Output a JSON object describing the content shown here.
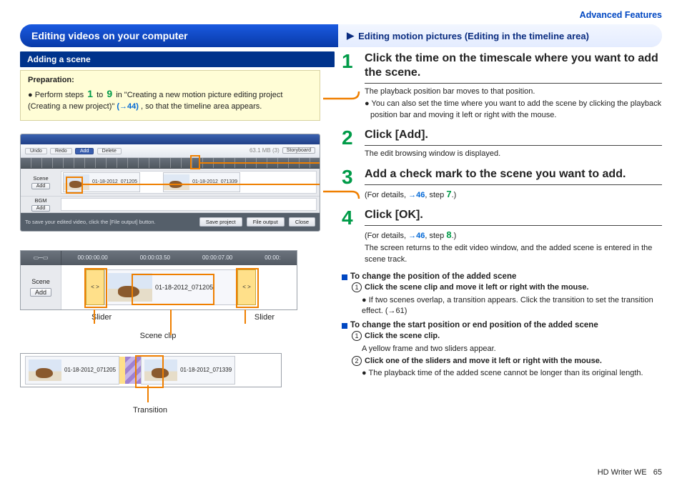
{
  "header": {
    "top_link": "Advanced Features",
    "left": "Editing videos on your computer",
    "right": "Editing motion pictures (Editing in the timeline area)"
  },
  "subheader": "Adding a scene",
  "prep": {
    "title": "Preparation:",
    "pre": "Perform steps ",
    "n1": "1",
    "mid": " to ",
    "n2": "9",
    "post1": " in \"Creating a new motion picture editing project (Creating a new project)\" ",
    "link": "(→44)",
    "post2": ", so that the timeline area appears."
  },
  "app": {
    "tabs": {
      "undo": "Undo",
      "redo": "Redo",
      "add": "Add",
      "delete": "Delete"
    },
    "size": "63.1 MB (3)",
    "storyboard": "Storyboard",
    "scene_label": "Scene",
    "add_btn": "Add",
    "bgm_label": "BGM",
    "clip1": "01-18-2012_071205",
    "clip2": "01-18-2012_071339",
    "foot_msg": "To save your edited video, click the [File output] button.",
    "save": "Save project",
    "file_out": "File output",
    "close": "Close"
  },
  "fig2": {
    "scene": "Scene",
    "add": "Add",
    "t0": "00:00:00.00",
    "t1": "00:00:03.50",
    "t2": "00:00:07.00",
    "t3": "00:00:",
    "sl": "< >",
    "clip": "01-18-2012_071205",
    "slider_l": "Slider",
    "slider_r": "Slider",
    "sceneclip": "Scene clip"
  },
  "fig3": {
    "c1": "01-18-2012_071205",
    "c2": "01-18-2012_071339",
    "transition": "Transition"
  },
  "steps": {
    "s1": {
      "n": "1",
      "title": "Click the time on the timescale where you want to add the scene.",
      "l1": "The playback position bar moves to that position.",
      "l2": "You can also set the time where you want to add the scene by clicking the playback position bar and moving it left or right with the mouse."
    },
    "s2": {
      "n": "2",
      "title": "Click [Add].",
      "l1": "The edit browsing window is displayed."
    },
    "s3": {
      "n": "3",
      "title": "Add a check mark to the scene you want to add.",
      "pre": "(For details, ",
      "lk": "→46",
      "mid": ", step ",
      "step": "7",
      "post": ".)"
    },
    "s4": {
      "n": "4",
      "title": "Click [OK].",
      "pre": "(For details, ",
      "lk": "→46",
      "mid": ", step ",
      "step": "8",
      "post": ".)",
      "l2": "The screen returns to the edit video window, and the added scene is entered in the scene track."
    }
  },
  "subs": {
    "a": {
      "title": "To change the position of the added scene",
      "c1": "Click the scene clip and move it left or right with the mouse.",
      "b1a": "If two scenes overlap, a transition appears. Click the transition to set the transition effect. ",
      "b1lk": "(→61)"
    },
    "b": {
      "title": "To change the start position or end position of the added scene",
      "c1": "Click the scene clip.",
      "l1": "A yellow frame and two sliders appear.",
      "c2": "Click one of the sliders and move it left or right with the mouse.",
      "b1": "The playback time of the added scene cannot be longer than its original length."
    }
  },
  "footer": {
    "product": "HD Writer WE",
    "page": "65"
  }
}
